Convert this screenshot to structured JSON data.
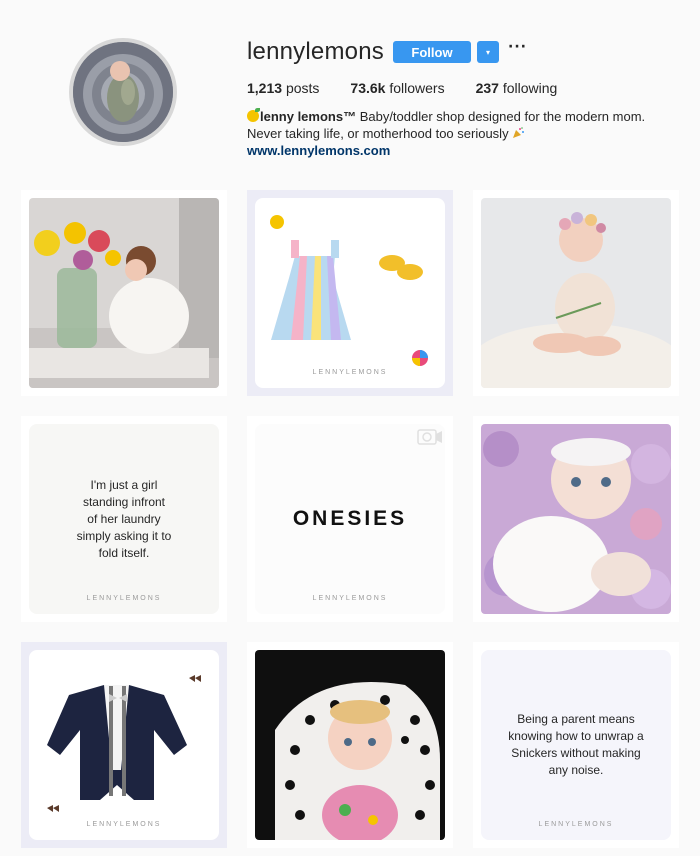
{
  "profile": {
    "username": "lennylemons",
    "follow_label": "Follow",
    "dropdown_glyph": "▾",
    "more_glyph": "···",
    "stats": [
      {
        "value": "1,213",
        "label": "posts"
      },
      {
        "value": "73.6k",
        "label": "followers"
      },
      {
        "value": "237",
        "label": "following"
      }
    ],
    "bio": {
      "name": "lenny lemons™",
      "line1": " Baby/toddler shop designed for the modern mom.",
      "line2": "Never taking life, or motherhood too seriously ",
      "link": "www.lennylemons.com",
      "name_icon": "lemon-emoji",
      "line2_icon": "party-popper-emoji"
    }
  },
  "posts": [
    {
      "id": "flowers-toddler",
      "kind": "photo"
    },
    {
      "id": "striped-dress",
      "kind": "product",
      "brand": "LENNYLEMONS"
    },
    {
      "id": "flower-crown-baby",
      "kind": "photo"
    },
    {
      "id": "laundry-quote",
      "kind": "quote",
      "text": "I'm just a girl\nstanding infront\nof her laundry\nsimply asking it to\nfold itself.",
      "brand": "LENNYLEMONS"
    },
    {
      "id": "onesies",
      "kind": "video",
      "text": "ONESIES",
      "brand": "LENNYLEMONS"
    },
    {
      "id": "baby-tutu",
      "kind": "photo"
    },
    {
      "id": "cardigan-onesie",
      "kind": "product",
      "brand": "LENNYLEMONS"
    },
    {
      "id": "polka-dot-baby",
      "kind": "photo"
    },
    {
      "id": "snickers-quote",
      "kind": "quote",
      "text": "Being a parent means\nknowing how to unwrap a\nSnickers without making\nany noise.",
      "brand": "LENNYLEMONS"
    }
  ],
  "colors": {
    "accent": "#3897f0",
    "link": "#003569",
    "background": "#fafafa"
  }
}
